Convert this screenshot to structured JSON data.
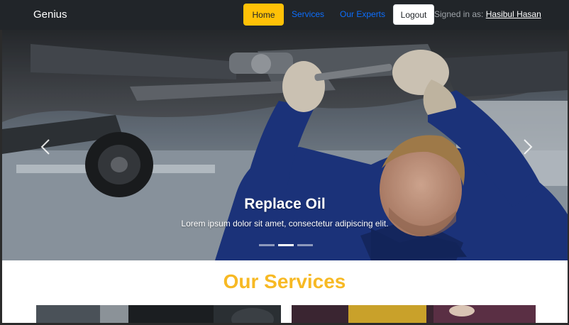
{
  "navbar": {
    "brand": "Genius",
    "links": {
      "home": "Home",
      "services": "Services",
      "experts": "Our Experts"
    },
    "logout_label": "Logout",
    "signed_in_prefix": "Signed in as:",
    "user_name": "Hasibul Hasan"
  },
  "carousel": {
    "title": "Replace Oil",
    "text": "Lorem ipsum dolor sit amet, consectetur adipiscing elit.",
    "slide_count": 3,
    "active_index": 1
  },
  "services": {
    "heading": "Our Services"
  },
  "colors": {
    "navbar_bg": "#212529",
    "accent": "#ffc107",
    "link": "#0d6efd",
    "heading": "#f7b924"
  }
}
